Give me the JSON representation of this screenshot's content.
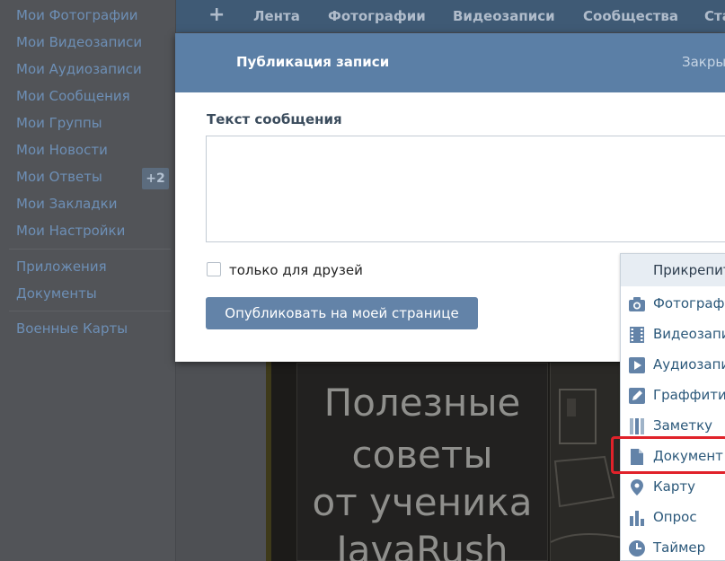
{
  "sidebar": {
    "items": [
      {
        "label": "Мои Фотографии"
      },
      {
        "label": "Мои Видеозаписи"
      },
      {
        "label": "Мои Аудиозаписи"
      },
      {
        "label": "Мои Сообщения"
      },
      {
        "label": "Мои Группы"
      },
      {
        "label": "Мои Новости"
      },
      {
        "label": "Мои Ответы",
        "badge": "+2"
      },
      {
        "label": "Мои Закладки"
      },
      {
        "label": "Мои Настройки"
      },
      {
        "label": "Приложения"
      },
      {
        "label": "Документы"
      },
      {
        "label": "Военные Карты"
      }
    ]
  },
  "topnav": {
    "plus": "+",
    "items": [
      "Лента",
      "Фотографии",
      "Видеозаписи",
      "Сообщества",
      "Ста"
    ]
  },
  "modal": {
    "title": "Публикация записи",
    "close_label": "Закры",
    "field_label": "Текст сообщения",
    "message_value": "",
    "friends_only_label": "только для друзей",
    "friends_only_checked": false,
    "publish_label": "Опубликовать на моей странице"
  },
  "attach_menu": {
    "header": "Прикрепит",
    "items": [
      {
        "label": "Фотографи",
        "icon": "camera-icon"
      },
      {
        "label": "Видеозапи",
        "icon": "film-icon"
      },
      {
        "label": "Аудиозапи",
        "icon": "play-icon"
      },
      {
        "label": "Граффити",
        "icon": "pencil-icon"
      },
      {
        "label": "Заметку",
        "icon": "note-icon"
      },
      {
        "label": "Документ",
        "icon": "document-icon",
        "highlighted": true
      },
      {
        "label": "Карту",
        "icon": "map-pin-icon"
      },
      {
        "label": "Опрос",
        "icon": "poll-icon"
      },
      {
        "label": "Таймер",
        "icon": "clock-icon"
      }
    ]
  },
  "banner": {
    "lines": [
      "Полезные",
      "советы",
      "от ученика",
      "JavaRush"
    ]
  },
  "colors": {
    "header_blue": "#5b7fa6",
    "button_blue": "#6383a8",
    "link_blue": "#2b587a",
    "highlight_red": "#e0222a"
  }
}
